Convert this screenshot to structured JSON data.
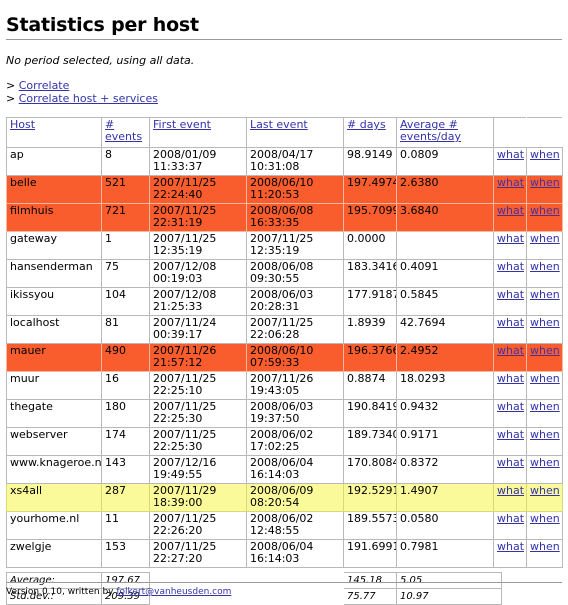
{
  "page": {
    "title": "Statistics per host",
    "period_note": "No period selected, using all data."
  },
  "nav": {
    "bullet": ">",
    "links": [
      {
        "label": "Correlate"
      },
      {
        "label": "Correlate host + services"
      }
    ]
  },
  "table": {
    "headers": {
      "host": "Host",
      "events_line1": "#",
      "events_line2": "events",
      "first_event": "First event",
      "last_event": "Last event",
      "days": "# days",
      "avg_line1": "Average #",
      "avg_line2": "events/day"
    },
    "actions": {
      "what": "what",
      "when": "when"
    },
    "rows": [
      {
        "host": "ap",
        "events": "8",
        "first_date": "2008/01/09",
        "first_time": "11:33:37",
        "last_date": "2008/04/17",
        "last_time": "10:31:08",
        "days": "98.9149",
        "avg": "0.0809",
        "style": "plain"
      },
      {
        "host": "belle",
        "events": "521",
        "first_date": "2007/11/25",
        "first_time": "22:24:40",
        "last_date": "2008/06/10",
        "last_time": "11:20:53",
        "days": "197.4974",
        "avg": "2.6380",
        "style": "orange"
      },
      {
        "host": "filmhuis",
        "events": "721",
        "first_date": "2007/11/25",
        "first_time": "22:31:19",
        "last_date": "2008/06/08",
        "last_time": "16:33:35",
        "days": "195.7099",
        "avg": "3.6840",
        "style": "orange"
      },
      {
        "host": "gateway",
        "events": "1",
        "first_date": "2007/11/25",
        "first_time": "12:35:19",
        "last_date": "2007/11/25",
        "last_time": "12:35:19",
        "days": "0.0000",
        "avg": "",
        "style": "plain"
      },
      {
        "host": "hansenderman",
        "events": "75",
        "first_date": "2007/12/08",
        "first_time": "00:19:03",
        "last_date": "2008/06/08",
        "last_time": "09:30:55",
        "days": "183.3416",
        "avg": "0.4091",
        "style": "plain"
      },
      {
        "host": "ikissyou",
        "events": "104",
        "first_date": "2007/12/08",
        "first_time": "21:25:33",
        "last_date": "2008/06/03",
        "last_time": "20:28:31",
        "days": "177.9187",
        "avg": "0.5845",
        "style": "plain"
      },
      {
        "host": "localhost",
        "events": "81",
        "first_date": "2007/11/24",
        "first_time": "00:39:17",
        "last_date": "2007/11/25",
        "last_time": "22:06:28",
        "days": "1.8939",
        "avg": "42.7694",
        "style": "plain"
      },
      {
        "host": "mauer",
        "events": "490",
        "first_date": "2007/11/26",
        "first_time": "21:57:12",
        "last_date": "2008/06/10",
        "last_time": "07:59:33",
        "days": "196.3766",
        "avg": "2.4952",
        "style": "orange"
      },
      {
        "host": "muur",
        "events": "16",
        "first_date": "2007/11/25",
        "first_time": "22:25:10",
        "last_date": "2007/11/26",
        "last_time": "19:43:05",
        "days": "0.8874",
        "avg": "18.0293",
        "style": "plain"
      },
      {
        "host": "thegate",
        "events": "180",
        "first_date": "2007/11/25",
        "first_time": "22:25:30",
        "last_date": "2008/06/03",
        "last_time": "19:37:50",
        "days": "190.8419",
        "avg": "0.9432",
        "style": "plain"
      },
      {
        "host": "webserver",
        "events": "174",
        "first_date": "2007/11/25",
        "first_time": "22:25:30",
        "last_date": "2008/06/02",
        "last_time": "17:02:25",
        "days": "189.7340",
        "avg": "0.9171",
        "style": "plain"
      },
      {
        "host": "www.knageroe.nl",
        "events": "143",
        "first_date": "2007/12/16",
        "first_time": "19:49:55",
        "last_date": "2008/06/04",
        "last_time": "16:14:03",
        "days": "170.8084",
        "avg": "0.8372",
        "style": "plain"
      },
      {
        "host": "xs4all",
        "events": "287",
        "first_date": "2007/11/29",
        "first_time": "18:39:00",
        "last_date": "2008/06/09",
        "last_time": "08:20:54",
        "days": "192.5291",
        "avg": "1.4907",
        "style": "yellow"
      },
      {
        "host": "yourhome.nl",
        "events": "11",
        "first_date": "2007/11/25",
        "first_time": "22:26:20",
        "last_date": "2008/06/02",
        "last_time": "12:48:55",
        "days": "189.5573",
        "avg": "0.0580",
        "style": "plain"
      },
      {
        "host": "zwelgje",
        "events": "153",
        "first_date": "2007/11/25",
        "first_time": "22:27:20",
        "last_date": "2008/06/04",
        "last_time": "16:14:03",
        "days": "191.6991",
        "avg": "0.7981",
        "style": "plain"
      }
    ]
  },
  "summary": {
    "rows": [
      {
        "label": "Average:",
        "events": "197.67",
        "first": "",
        "last": "",
        "days": "145.18",
        "avg": "5.05"
      },
      {
        "label": "Std.dev.:",
        "events": "209.39",
        "first": "",
        "last": "",
        "days": "75.77",
        "avg": "10.97"
      }
    ]
  },
  "footer": {
    "prefix": "Version 0.10, written by ",
    "email": "folkert@vanheusden.com"
  },
  "colors": {
    "row_orange": "#f95d2e",
    "row_yellow": "#fafa9a",
    "link": "#3333aa",
    "border": "#b9b9b9"
  }
}
